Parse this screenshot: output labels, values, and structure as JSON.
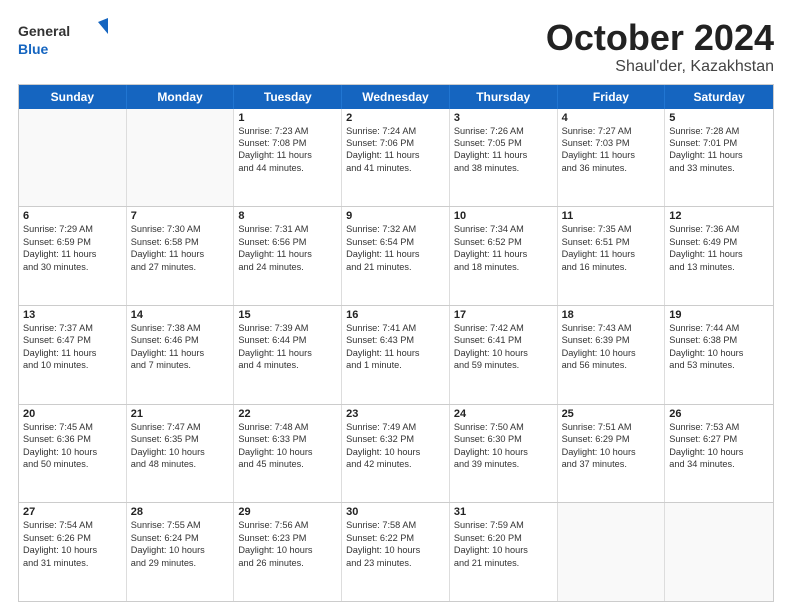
{
  "logo": {
    "general": "General",
    "blue": "Blue"
  },
  "title": "October 2024",
  "subtitle": "Shaul'der, Kazakhstan",
  "days": [
    "Sunday",
    "Monday",
    "Tuesday",
    "Wednesday",
    "Thursday",
    "Friday",
    "Saturday"
  ],
  "rows": [
    [
      {
        "day": "",
        "empty": true
      },
      {
        "day": "",
        "empty": true
      },
      {
        "day": "1",
        "line1": "Sunrise: 7:23 AM",
        "line2": "Sunset: 7:08 PM",
        "line3": "Daylight: 11 hours",
        "line4": "and 44 minutes."
      },
      {
        "day": "2",
        "line1": "Sunrise: 7:24 AM",
        "line2": "Sunset: 7:06 PM",
        "line3": "Daylight: 11 hours",
        "line4": "and 41 minutes."
      },
      {
        "day": "3",
        "line1": "Sunrise: 7:26 AM",
        "line2": "Sunset: 7:05 PM",
        "line3": "Daylight: 11 hours",
        "line4": "and 38 minutes."
      },
      {
        "day": "4",
        "line1": "Sunrise: 7:27 AM",
        "line2": "Sunset: 7:03 PM",
        "line3": "Daylight: 11 hours",
        "line4": "and 36 minutes."
      },
      {
        "day": "5",
        "line1": "Sunrise: 7:28 AM",
        "line2": "Sunset: 7:01 PM",
        "line3": "Daylight: 11 hours",
        "line4": "and 33 minutes."
      }
    ],
    [
      {
        "day": "6",
        "line1": "Sunrise: 7:29 AM",
        "line2": "Sunset: 6:59 PM",
        "line3": "Daylight: 11 hours",
        "line4": "and 30 minutes."
      },
      {
        "day": "7",
        "line1": "Sunrise: 7:30 AM",
        "line2": "Sunset: 6:58 PM",
        "line3": "Daylight: 11 hours",
        "line4": "and 27 minutes."
      },
      {
        "day": "8",
        "line1": "Sunrise: 7:31 AM",
        "line2": "Sunset: 6:56 PM",
        "line3": "Daylight: 11 hours",
        "line4": "and 24 minutes."
      },
      {
        "day": "9",
        "line1": "Sunrise: 7:32 AM",
        "line2": "Sunset: 6:54 PM",
        "line3": "Daylight: 11 hours",
        "line4": "and 21 minutes."
      },
      {
        "day": "10",
        "line1": "Sunrise: 7:34 AM",
        "line2": "Sunset: 6:52 PM",
        "line3": "Daylight: 11 hours",
        "line4": "and 18 minutes."
      },
      {
        "day": "11",
        "line1": "Sunrise: 7:35 AM",
        "line2": "Sunset: 6:51 PM",
        "line3": "Daylight: 11 hours",
        "line4": "and 16 minutes."
      },
      {
        "day": "12",
        "line1": "Sunrise: 7:36 AM",
        "line2": "Sunset: 6:49 PM",
        "line3": "Daylight: 11 hours",
        "line4": "and 13 minutes."
      }
    ],
    [
      {
        "day": "13",
        "line1": "Sunrise: 7:37 AM",
        "line2": "Sunset: 6:47 PM",
        "line3": "Daylight: 11 hours",
        "line4": "and 10 minutes."
      },
      {
        "day": "14",
        "line1": "Sunrise: 7:38 AM",
        "line2": "Sunset: 6:46 PM",
        "line3": "Daylight: 11 hours",
        "line4": "and 7 minutes."
      },
      {
        "day": "15",
        "line1": "Sunrise: 7:39 AM",
        "line2": "Sunset: 6:44 PM",
        "line3": "Daylight: 11 hours",
        "line4": "and 4 minutes."
      },
      {
        "day": "16",
        "line1": "Sunrise: 7:41 AM",
        "line2": "Sunset: 6:43 PM",
        "line3": "Daylight: 11 hours",
        "line4": "and 1 minute."
      },
      {
        "day": "17",
        "line1": "Sunrise: 7:42 AM",
        "line2": "Sunset: 6:41 PM",
        "line3": "Daylight: 10 hours",
        "line4": "and 59 minutes."
      },
      {
        "day": "18",
        "line1": "Sunrise: 7:43 AM",
        "line2": "Sunset: 6:39 PM",
        "line3": "Daylight: 10 hours",
        "line4": "and 56 minutes."
      },
      {
        "day": "19",
        "line1": "Sunrise: 7:44 AM",
        "line2": "Sunset: 6:38 PM",
        "line3": "Daylight: 10 hours",
        "line4": "and 53 minutes."
      }
    ],
    [
      {
        "day": "20",
        "line1": "Sunrise: 7:45 AM",
        "line2": "Sunset: 6:36 PM",
        "line3": "Daylight: 10 hours",
        "line4": "and 50 minutes."
      },
      {
        "day": "21",
        "line1": "Sunrise: 7:47 AM",
        "line2": "Sunset: 6:35 PM",
        "line3": "Daylight: 10 hours",
        "line4": "and 48 minutes."
      },
      {
        "day": "22",
        "line1": "Sunrise: 7:48 AM",
        "line2": "Sunset: 6:33 PM",
        "line3": "Daylight: 10 hours",
        "line4": "and 45 minutes."
      },
      {
        "day": "23",
        "line1": "Sunrise: 7:49 AM",
        "line2": "Sunset: 6:32 PM",
        "line3": "Daylight: 10 hours",
        "line4": "and 42 minutes."
      },
      {
        "day": "24",
        "line1": "Sunrise: 7:50 AM",
        "line2": "Sunset: 6:30 PM",
        "line3": "Daylight: 10 hours",
        "line4": "and 39 minutes."
      },
      {
        "day": "25",
        "line1": "Sunrise: 7:51 AM",
        "line2": "Sunset: 6:29 PM",
        "line3": "Daylight: 10 hours",
        "line4": "and 37 minutes."
      },
      {
        "day": "26",
        "line1": "Sunrise: 7:53 AM",
        "line2": "Sunset: 6:27 PM",
        "line3": "Daylight: 10 hours",
        "line4": "and 34 minutes."
      }
    ],
    [
      {
        "day": "27",
        "line1": "Sunrise: 7:54 AM",
        "line2": "Sunset: 6:26 PM",
        "line3": "Daylight: 10 hours",
        "line4": "and 31 minutes."
      },
      {
        "day": "28",
        "line1": "Sunrise: 7:55 AM",
        "line2": "Sunset: 6:24 PM",
        "line3": "Daylight: 10 hours",
        "line4": "and 29 minutes."
      },
      {
        "day": "29",
        "line1": "Sunrise: 7:56 AM",
        "line2": "Sunset: 6:23 PM",
        "line3": "Daylight: 10 hours",
        "line4": "and 26 minutes."
      },
      {
        "day": "30",
        "line1": "Sunrise: 7:58 AM",
        "line2": "Sunset: 6:22 PM",
        "line3": "Daylight: 10 hours",
        "line4": "and 23 minutes."
      },
      {
        "day": "31",
        "line1": "Sunrise: 7:59 AM",
        "line2": "Sunset: 6:20 PM",
        "line3": "Daylight: 10 hours",
        "line4": "and 21 minutes."
      },
      {
        "day": "",
        "empty": true
      },
      {
        "day": "",
        "empty": true
      }
    ]
  ]
}
